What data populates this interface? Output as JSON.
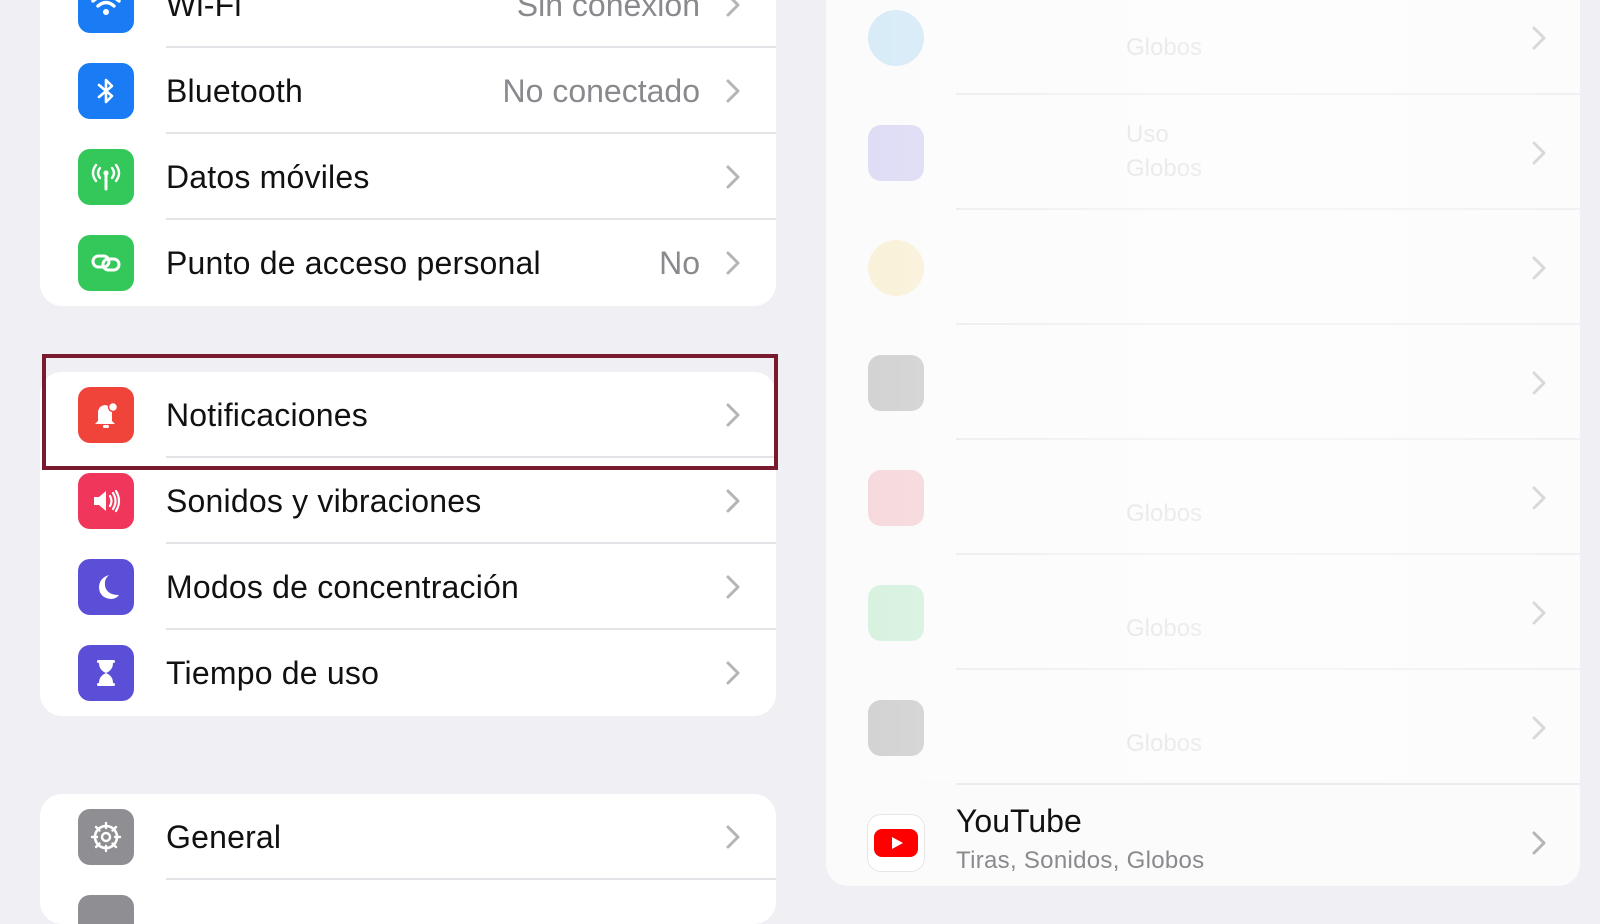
{
  "settings": {
    "group1": [
      {
        "label": "Wi-Fi",
        "value": "Sin conexión",
        "icon": "wifi-icon",
        "color": "#1a7cf5"
      },
      {
        "label": "Bluetooth",
        "value": "No conectado",
        "icon": "bluetooth-icon",
        "color": "#1a7cf5"
      },
      {
        "label": "Datos móviles",
        "value": "",
        "icon": "antenna-icon",
        "color": "#34c759"
      },
      {
        "label": "Punto de acceso personal",
        "value": "No",
        "icon": "hotspot-icon",
        "color": "#34c759"
      }
    ],
    "group2": [
      {
        "label": "Notificaciones",
        "icon": "bell-icon",
        "color": "#f0443a"
      },
      {
        "label": "Sonidos y vibraciones",
        "icon": "speaker-icon",
        "color": "#f0365a"
      },
      {
        "label": "Modos de concentración",
        "icon": "moon-icon",
        "color": "#5b4fd8"
      },
      {
        "label": "Tiempo de uso",
        "icon": "hourglass-icon",
        "color": "#5b4fd8"
      }
    ],
    "group3": [
      {
        "label": "General",
        "icon": "gear-icon",
        "color": "#8e8e93"
      }
    ]
  },
  "notifications_panel": {
    "ghost_texts": [
      "Globos",
      "Uso",
      "Globos",
      "",
      "",
      "Globos",
      "Globos",
      "Globos"
    ],
    "youtube": {
      "title": "YouTube",
      "subtitle": "Tiras, Sonidos, Globos",
      "icon": "youtube-icon",
      "color": "#ff0000"
    }
  }
}
